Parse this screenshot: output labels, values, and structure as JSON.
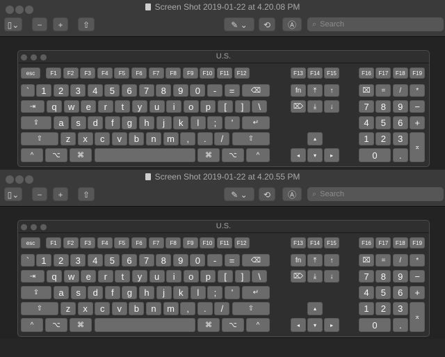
{
  "windows": [
    {
      "title": "Screen Shot 2019-01-22 at 4.20.08 PM",
      "toolbar": {
        "sidebar_icon": "▯⌄",
        "zoom_out": "−",
        "zoom_in": "+",
        "share": "⇧",
        "markup": "✎ ⌄",
        "rotate": "⟲",
        "annotate": "Ⓐ",
        "search_placeholder": "Search"
      },
      "keyboard_title": "U.S."
    },
    {
      "title": "Screen Shot 2019-01-22 at 4.20.55 PM",
      "toolbar": {
        "sidebar_icon": "▯⌄",
        "zoom_out": "−",
        "zoom_in": "+",
        "share": "⇧",
        "markup": "✎ ⌄",
        "rotate": "⟲",
        "annotate": "Ⓐ",
        "search_placeholder": "Search"
      },
      "keyboard_title": "U.S."
    }
  ],
  "keyboard": {
    "function_row": [
      "esc",
      "F1",
      "F2",
      "F3",
      "F4",
      "F5",
      "F6",
      "F7",
      "F8",
      "F9",
      "F10",
      "F11",
      "F12"
    ],
    "number_row": [
      "`",
      "1",
      "2",
      "3",
      "4",
      "5",
      "6",
      "7",
      "8",
      "9",
      "0",
      "-",
      "=",
      "⌫"
    ],
    "qwerty_row": [
      "⇥",
      "q",
      "w",
      "e",
      "r",
      "t",
      "y",
      "u",
      "i",
      "o",
      "p",
      "[",
      "]",
      "\\"
    ],
    "home_row": [
      "⇪",
      "a",
      "s",
      "d",
      "f",
      "g",
      "h",
      "j",
      "k",
      "l",
      ";",
      "'",
      "↵"
    ],
    "shift_row": [
      "⇧",
      "z",
      "x",
      "c",
      "v",
      "b",
      "n",
      "m",
      ",",
      ".",
      "/",
      "⇧"
    ],
    "bottom_row": [
      "^",
      "⌥",
      "⌘",
      "",
      "⌘",
      "⌥",
      "^"
    ],
    "nav_f": [
      "F13",
      "F14",
      "F15"
    ],
    "nav_row1": [
      "fn",
      "⤒",
      "↑"
    ],
    "nav_row2": [
      "⌦",
      "⤓",
      "↓"
    ],
    "arrows": [
      "▴",
      "◂",
      "▾",
      "▸"
    ],
    "pad_f": [
      "F16",
      "F17",
      "F18",
      "F19"
    ],
    "pad_row1": [
      "⌧",
      "=",
      "/",
      "*"
    ],
    "pad_row2": [
      "7",
      "8",
      "9",
      "−"
    ],
    "pad_row3": [
      "4",
      "5",
      "6",
      "+"
    ],
    "pad_row4": [
      "1",
      "2",
      "3"
    ],
    "pad_row5": [
      "0",
      "."
    ],
    "pad_enter": "⌅"
  }
}
